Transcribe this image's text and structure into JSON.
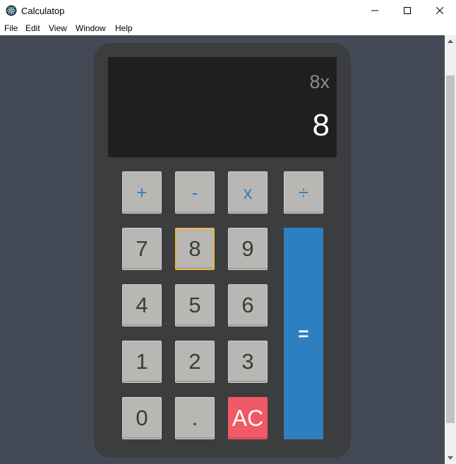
{
  "window": {
    "title": "Calculatop",
    "controls": {
      "minimize": "–",
      "maximize": "☐",
      "close": "✕"
    }
  },
  "menu": [
    "File",
    "Edit",
    "View",
    "Window",
    "Help"
  ],
  "display": {
    "expression": "8x",
    "value": "8"
  },
  "keys": {
    "plus": "+",
    "minus": "-",
    "multiply": "x",
    "divide": "÷",
    "seven": "7",
    "eight": "8",
    "nine": "9",
    "four": "4",
    "five": "5",
    "six": "6",
    "one": "1",
    "two": "2",
    "three": "3",
    "zero": "0",
    "dot": ".",
    "clear": "AC",
    "equals": "="
  },
  "colors": {
    "background": "#434a56",
    "calculator_body": "#3c3d3f",
    "display_background": "#1e1f20",
    "key": "#b9b7b4",
    "operator_text": "#2e7fc0",
    "equals": "#2e7fc0",
    "clear": "#f05965",
    "focused_key_border": "#f2b53a"
  },
  "icons": {
    "app": "electron-atom-icon"
  }
}
